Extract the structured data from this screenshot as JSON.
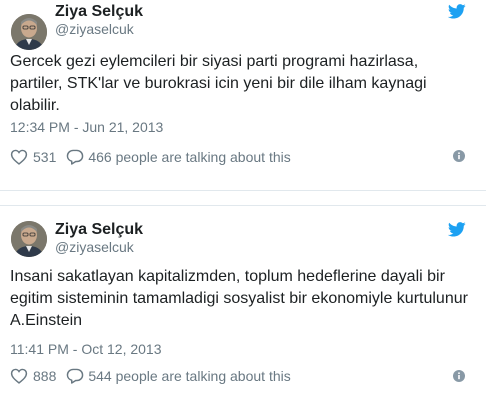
{
  "colors": {
    "text_primary": "#1c2022",
    "text_secondary": "#697882",
    "twitter_blue": "#1da1f2",
    "divider": "#e1e8ed"
  },
  "icons": {
    "brand": "twitter-bird-icon",
    "like": "heart-icon",
    "reply": "speech-bubble-icon",
    "info": "info-icon"
  },
  "tweets": [
    {
      "author": {
        "name": "Ziya Selçuk",
        "handle": "@ziyaselcuk"
      },
      "text_lines": [
        "Gercek gezi eylemcileri bir siyasi parti programi hazirlasa,",
        "partiler, STK'lar ve burokrasi icin yeni bir dile ilham kaynagi",
        "olabilir."
      ],
      "timestamp": "12:34 PM - Jun 21, 2013",
      "likes": "531",
      "replies": "466 people are talking about this"
    },
    {
      "author": {
        "name": "Ziya Selçuk",
        "handle": "@ziyaselcuk"
      },
      "text_lines": [
        "Insani sakatlayan  kapitalizmden, toplum hedeflerine dayali bir",
        "egitim sisteminin tamamladigi sosyalist bir ekonomiyle kurtulunur",
        "A.Einstein"
      ],
      "timestamp": "11:41 PM - Oct 12, 2013",
      "likes": "888",
      "replies": "544 people are talking about this"
    }
  ]
}
